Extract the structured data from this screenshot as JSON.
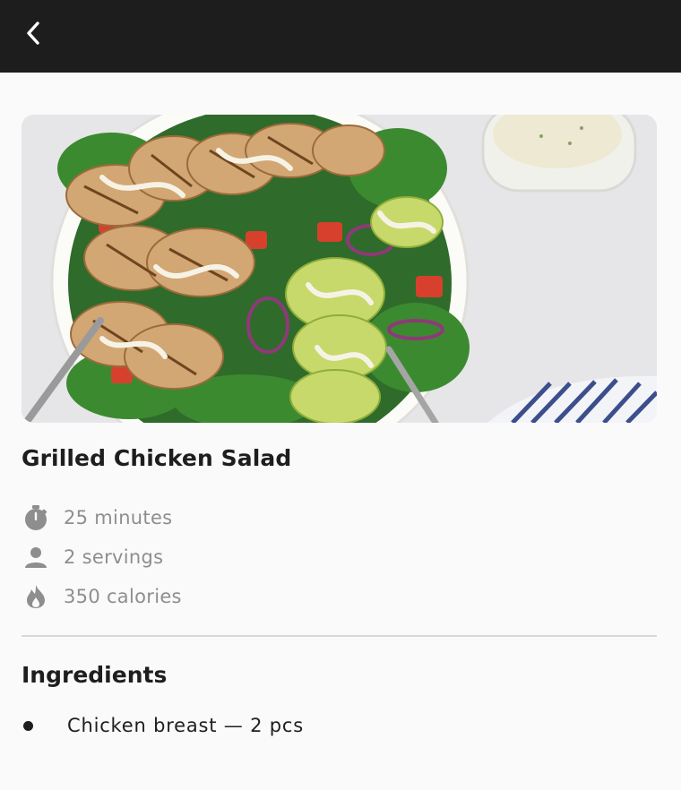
{
  "appbar": {
    "back_icon": "chevron-left-icon"
  },
  "recipe": {
    "title": "Grilled Chicken Salad",
    "meta": [
      {
        "icon": "timer-icon",
        "text": "25 minutes"
      },
      {
        "icon": "person-icon",
        "text": "2 servings"
      },
      {
        "icon": "flame-icon",
        "text": "350 calories"
      }
    ]
  },
  "ingredients": {
    "heading": "Ingredients",
    "items": [
      "Chicken breast — 2 pcs"
    ]
  },
  "colors": {
    "appbar": "#1d1d1d",
    "background": "#fafafa",
    "muted_text": "#8e8e8e"
  }
}
